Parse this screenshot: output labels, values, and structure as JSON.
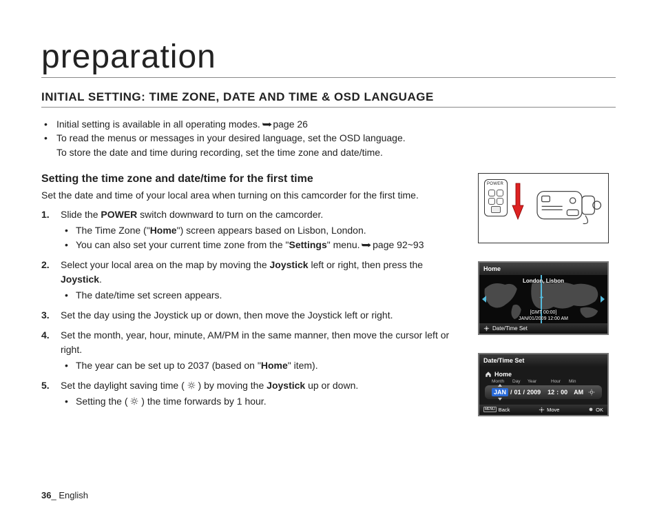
{
  "page": {
    "title": "preparation",
    "section_heading": "INITIAL SETTING: TIME ZONE, DATE AND TIME & OSD LANGUAGE",
    "number": "36",
    "lang": "English",
    "underscore": "_ "
  },
  "intro": {
    "b1a": "Initial setting is available in all operating modes. ",
    "b1_arrow": "➥",
    "b1b": "page 26",
    "b2_l1": "To read the menus or messages in your desired language, set the OSD language.",
    "b2_l2": "To store the date and time during recording, set the time zone and date/time."
  },
  "sub": {
    "heading": "Setting the time zone and date/time for the first time",
    "intro": "Set the date and time of your local area when turning on this camcorder for the first time."
  },
  "steps": {
    "s1": {
      "a": "Slide the ",
      "b": "POWER",
      "c": " switch downward to turn on the camcorder.",
      "sub1a": "The Time Zone (\"",
      "sub1b": "Home",
      "sub1c": "\") screen appears based on Lisbon, London.",
      "sub2a": "You can also set your current time zone from the \"",
      "sub2b": "Settings",
      "sub2c": "\" menu. ",
      "sub2_arrow": "➥",
      "sub2d": "page 92~93"
    },
    "s2": {
      "a": "Select your local area on the map by moving the ",
      "b": "Joystick",
      "c": " left or right, then press the ",
      "d": "Joystick",
      "e": ".",
      "sub1": "The date/time set screen appears."
    },
    "s3": "Set the day using the Joystick up or down, then move the Joystick left or right.",
    "s4": {
      "a": "Set the month, year, hour, minute, AM/PM in the same manner, then move the cursor left or right.",
      "sub1a": "The year can be set up to 2037 (based on \"",
      "sub1b": "Home",
      "sub1c": "\" item)."
    },
    "s5": {
      "a": "Set the daylight saving time (",
      "b": ") by moving the ",
      "c": "Joystick",
      "d": " up or down.",
      "sub1a": "Setting the (",
      "sub1b": ") the time forwards by 1 hour."
    }
  },
  "power": {
    "label": "POWER"
  },
  "osd_home": {
    "title": "Home",
    "location": "London, Lisbon",
    "gmt": "[GMT 00:00]",
    "datetime": "JAN/01/2009 12:00 AM",
    "footer": "Date/Time Set"
  },
  "osd_dt": {
    "title": "Date/Time Set",
    "home": "Home",
    "headers": {
      "month": "Month",
      "day": "Day",
      "year": "Year",
      "hour": "Hour",
      "min": "Min"
    },
    "vals": {
      "month": "JAN",
      "sep1": "/",
      "day": "01",
      "sep2": "/",
      "year": "2009",
      "hour": "12",
      "colon": ":",
      "min": "00",
      "ampm": "AM"
    },
    "footer": {
      "menu": "MENU",
      "back": "Back",
      "move": "Move",
      "ok": "OK"
    }
  }
}
